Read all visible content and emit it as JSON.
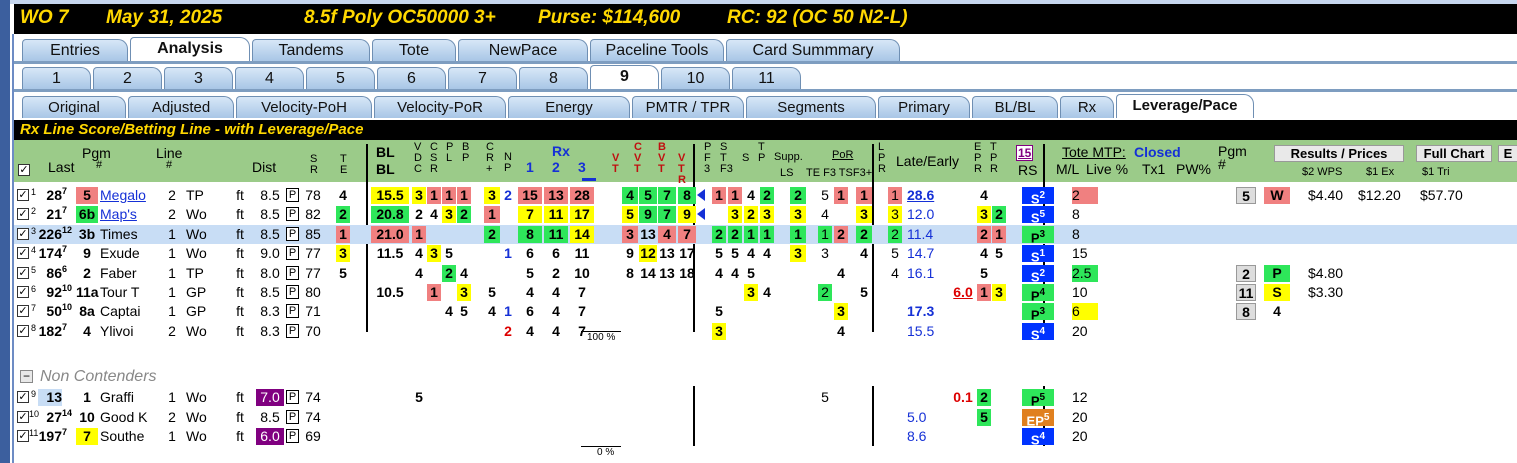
{
  "race_header": {
    "wo": "WO 7",
    "date": "May 31, 2025",
    "race": "8.5f Poly OC50000 3+",
    "purse": "Purse: $114,600",
    "rc": "RC: 92 (OC 50 N2-L)"
  },
  "tabs_main": [
    "Entries",
    "Analysis",
    "Tandems",
    "Tote",
    "NewPace",
    "Paceline Tools",
    "Card Summmary"
  ],
  "tabs_races": [
    "1",
    "2",
    "3",
    "4",
    "5",
    "6",
    "7",
    "8",
    "9",
    "10",
    "11"
  ],
  "tabs_views": [
    "Original",
    "Adjusted",
    "Velocity-PoH",
    "Velocity-PoR",
    "Energy",
    "PMTR / TPR",
    "Segments",
    "Primary",
    "BL/BL",
    "Rx",
    "Leverage/Pace"
  ],
  "section_title": "Rx Line Score/Betting Line - with Leverage/Pace",
  "headers": {
    "last": "Last",
    "pgm": "Pgm",
    "line": "Line",
    "dist": "Dist",
    "sr": "S R",
    "te": "T E",
    "blbl": "BL BL",
    "vdc": "V D C",
    "csr": "C S R",
    "pl": "P L",
    "bp": "B P",
    "rp": "C R +",
    "np": "N P",
    "rx": "Rx",
    "rx1": "1",
    "rx2": "2",
    "rx3": "3",
    "vt": "V T",
    "cvt": "C V T",
    "bvt": "B V T",
    "bvr": "V T R",
    "pf3": "P F 3",
    "tf3": "S T F3",
    "s": "S",
    "tp": "T P",
    "supp": "Supp.",
    "ls": "LS",
    "por": "PoR",
    "tef3": "TE F3 TSF3+",
    "lpr": "L P R",
    "late": "Late/Early",
    "epr": "E P R",
    "tpr": "T P R",
    "rs15": "15",
    "rs": "RS",
    "tote": "Tote MTP:",
    "closed": "Closed",
    "ml": "M/L",
    "live": "Live %",
    "tx1": "Tx1",
    "pw": "PW%",
    "pgm2": "Pgm #",
    "results": "Results / Prices",
    "fullchart": "Full Chart",
    "wps": "$2 WPS",
    "ex": "$1 Ex",
    "tri": "$1 Tri",
    "pct1": "100 %",
    "pct2": "0 %",
    "noncont": "Non Contenders"
  },
  "rows": [
    {
      "n": "1",
      "last": "28",
      "lsup": "7",
      "pgm": "5",
      "name": "Megalo",
      "line": "2",
      "trk": "TP",
      "ft": "ft",
      "dist": "8.5",
      "sr": "78",
      "te": "4",
      "bl": "15.5",
      "a": "3",
      "b": "1",
      "c": "1",
      "d": "1",
      "e": "3",
      "f": "2",
      "rx1": "15",
      "rx2": "13",
      "rx3": "28",
      "v1": "4",
      "v2": "5",
      "v3": "7",
      "v4": "8",
      "p1": "1",
      "p2": "1",
      "p3": "4",
      "p4": "2",
      "p5": "2",
      "q1": "5",
      "q2": "1",
      "q3": "1",
      "lp": "1",
      "late": "28.6",
      "ep": "4",
      "rs": "S",
      "rss": "2",
      "ml": "2",
      "rpgm": "5",
      "rpos": "W",
      "w": "$4.40",
      "ex": "$12.20",
      "tri": "$57.70"
    },
    {
      "n": "2",
      "last": "21",
      "lsup": "7",
      "pgm": "6b",
      "name": "Map's",
      "line": "2",
      "trk": "Wo",
      "ft": "ft",
      "dist": "8.5",
      "sr": "82",
      "te": "2",
      "bl": "20.8",
      "a": "2",
      "b": "4",
      "c": "3",
      "d": "2",
      "e": "1",
      "f": "",
      "rx1": "7",
      "rx2": "11",
      "rx3": "17",
      "v1": "5",
      "v2": "9",
      "v3": "7",
      "v4": "9",
      "p1": "",
      "p2": "3",
      "p3": "2",
      "p4": "3",
      "p5": "3",
      "q1": "4",
      "q2": "",
      "q3": "3",
      "lp": "3",
      "late": "12.0",
      "ep": "3",
      "ep2": "2",
      "rs": "S",
      "rss": "5",
      "ml": "8"
    },
    {
      "n": "3",
      "last": "226",
      "lsup": "12",
      "pgm": "3b",
      "name": "Times",
      "line": "1",
      "trk": "Wo",
      "ft": "ft",
      "dist": "8.5",
      "sr": "85",
      "te": "1",
      "bl": "21.0",
      "a": "1",
      "e": "2",
      "rx1": "8",
      "rx2": "11",
      "rx3": "14",
      "v1": "3",
      "v2": "13",
      "v3": "4",
      "v4": "7",
      "p1": "2",
      "p2": "2",
      "p3": "1",
      "p4": "1",
      "p5": "1",
      "q1": "1",
      "q2": "2",
      "q3": "2",
      "lp": "2",
      "late": "11.4",
      "ep": "2",
      "ep2": "1",
      "rs": "P",
      "rss": "3",
      "ml": "8"
    },
    {
      "n": "4",
      "last": "174",
      "lsup": "7",
      "pgm": "9",
      "name": "Exude",
      "line": "1",
      "trk": "Wo",
      "ft": "ft",
      "dist": "9.0",
      "sr": "77",
      "te": "3",
      "bl": "11.5",
      "a": "4",
      "b": "3",
      "c": "5",
      "f": "1",
      "rx1": "6",
      "rx2": "6",
      "rx3": "11",
      "v1": "9",
      "v2": "12",
      "v3": "13",
      "v4": "17",
      "p1": "5",
      "p2": "5",
      "p3": "4",
      "p4": "4",
      "p5": "3",
      "q1": "3",
      "q3": "4",
      "lp": "5",
      "late": "14.7",
      "ep": "4",
      "ep2": "5",
      "rs": "S",
      "rss": "1",
      "ml": "15"
    },
    {
      "n": "5",
      "last": "86",
      "lsup": "6",
      "pgm": "2",
      "name": "Faber",
      "line": "1",
      "trk": "TP",
      "ft": "ft",
      "dist": "8.0",
      "sr": "77",
      "te": "5",
      "a": "4",
      "c": "2",
      "d": "4",
      "rx1": "5",
      "rx2": "2",
      "rx3": "10",
      "v1": "8",
      "v2": "14",
      "v3": "13",
      "v4": "18",
      "p1": "4",
      "p2": "4",
      "p3": "5",
      "q2": "4",
      "lp": "4",
      "late": "16.1",
      "ep": "5",
      "rs": "S",
      "rss": "2",
      "ml": "2.5",
      "rpgm": "2",
      "rpos": "P",
      "w": "$4.80"
    },
    {
      "n": "6",
      "last": "92",
      "lsup": "10",
      "pgm": "11a",
      "name": "Tour T",
      "line": "1",
      "trk": "GP",
      "ft": "ft",
      "dist": "8.5",
      "sr": "80",
      "bl": "10.5",
      "b": "1",
      "d": "3",
      "e": "5",
      "rx1": "4",
      "rx2": "4",
      "rx3": "7",
      "p3": "3",
      "p4": "4",
      "q1": "2",
      "q3": "5",
      "late2": "6.0",
      "ep": "1",
      "ep2": "3",
      "rs": "P",
      "rss": "4",
      "ml": "10",
      "rpgm": "11",
      "rpos": "S",
      "w": "$3.30"
    },
    {
      "n": "7",
      "last": "50",
      "lsup": "10",
      "pgm": "8a",
      "name": "Captai",
      "line": "1",
      "trk": "GP",
      "ft": "ft",
      "dist": "8.3",
      "sr": "71",
      "c": "4",
      "d": "5",
      "e": "4",
      "f": "1",
      "rx1": "6",
      "rx2": "4",
      "rx3": "7",
      "p1": "5",
      "q2": "3",
      "late": "17.3",
      "rs": "P",
      "rss": "3",
      "ml": "6",
      "rpgm": "8",
      "rpos": "4"
    },
    {
      "n": "8",
      "last": "182",
      "lsup": "7",
      "pgm": "4",
      "name": "Ylivoi",
      "line": "2",
      "trk": "Wo",
      "ft": "ft",
      "dist": "8.3",
      "sr": "70",
      "f": "2",
      "rx1": "4",
      "rx2": "4",
      "rx3": "7",
      "p1": "3",
      "q2": "4",
      "late": "15.5",
      "rs": "S",
      "rss": "4",
      "ml": "20"
    }
  ],
  "noncont": [
    {
      "n": "9",
      "last": "13",
      "pgm": "1",
      "name": "Graffi",
      "line": "1",
      "trk": "Wo",
      "ft": "ft",
      "dist": "7.0",
      "sr": "74",
      "a": "5",
      "q1": "5",
      "late2": "0.1",
      "ep": "2",
      "rs": "P",
      "rss": "5",
      "ml": "12"
    },
    {
      "n": "10",
      "last": "27",
      "lsup": "14",
      "pgm": "10",
      "name": "Good K",
      "line": "2",
      "trk": "Wo",
      "ft": "ft",
      "dist": "8.5",
      "sr": "74",
      "late": "5.0",
      "ep": "5",
      "rs": "EP",
      "rss": "5",
      "ml": "20"
    },
    {
      "n": "11",
      "last": "197",
      "lsup": "7",
      "pgm": "7",
      "name": "Southe",
      "line": "1",
      "trk": "Wo",
      "ft": "ft",
      "dist": "6.0",
      "sr": "69",
      "late": "8.6",
      "rs": "S",
      "rss": "4",
      "ml": "20"
    }
  ],
  "colors": {
    "title_bg": "#000000",
    "title_fg": "#ffd800",
    "header_bg": "#9bcb89",
    "yellow": "#ffff00",
    "green": "#2ee65a",
    "pink": "#f08080",
    "blue": "#0033ff",
    "purple": "#800080"
  }
}
